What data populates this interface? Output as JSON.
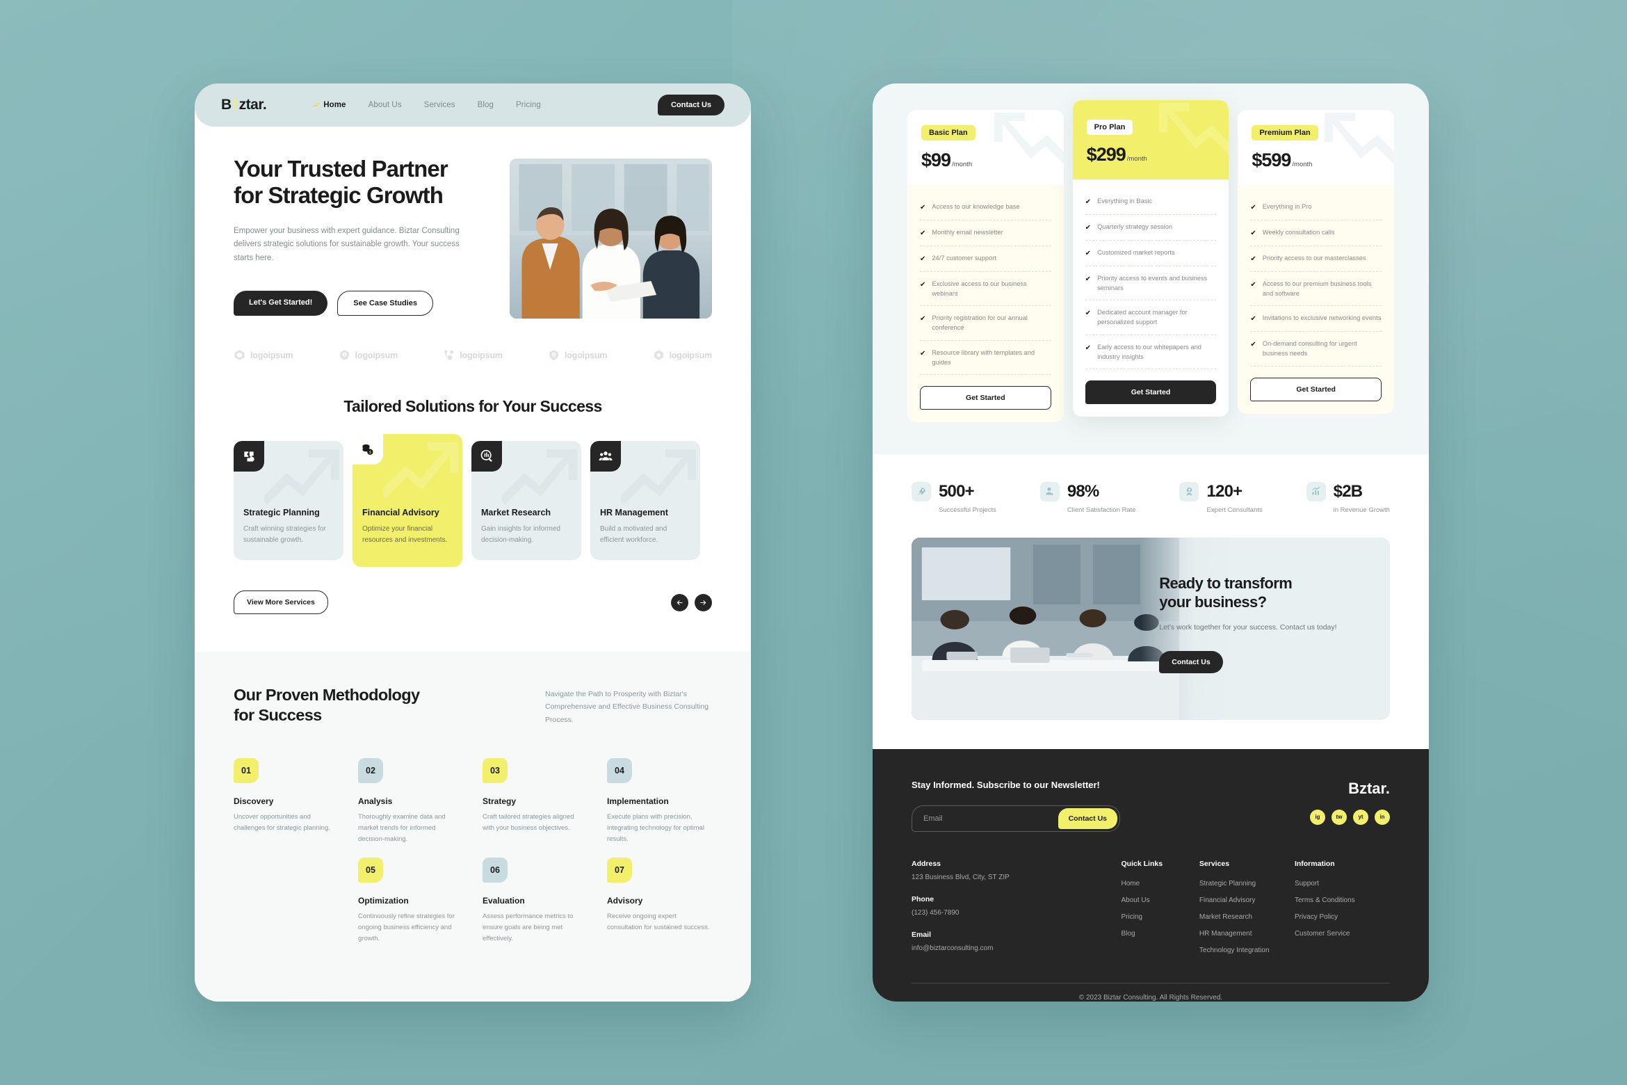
{
  "brand": {
    "name_pre": "B",
    "name_post": "ztar.",
    "logo_icon": "arrow-up-icon"
  },
  "nav": {
    "items": [
      {
        "label": "Home",
        "active": true
      },
      {
        "label": "About Us",
        "active": false
      },
      {
        "label": "Services",
        "active": false
      },
      {
        "label": "Blog",
        "active": false
      },
      {
        "label": "Pricing",
        "active": false
      }
    ],
    "cta": "Contact Us"
  },
  "hero": {
    "title_line1": "Your Trusted Partner",
    "title_line2": "for Strategic Growth",
    "subtitle": "Empower your business with expert guidance. Biztar Consulting delivers strategic solutions for sustainable growth. Your success starts here.",
    "primary_btn": "Let's Get Started!",
    "secondary_btn": "See Case Studies"
  },
  "logos": [
    {
      "label": "logoipsum",
      "icon": "cube-icon"
    },
    {
      "label": "logoipsum",
      "icon": "shield-plus-icon"
    },
    {
      "label": "logoipsum",
      "icon": "molecule-icon"
    },
    {
      "label": "logoipsum",
      "icon": "shield-plus-icon"
    },
    {
      "label": "logoipsum",
      "icon": "hexagon-icon"
    }
  ],
  "services": {
    "title": "Tailored Solutions for Your Success",
    "cards": [
      {
        "title": "Strategic Planning",
        "desc": "Craft winning strategies for sustainable growth.",
        "icon": "puzzle-icon",
        "highlight": false
      },
      {
        "title": "Financial Advisory",
        "desc": "Optimize your financial resources and investments.",
        "icon": "coins-icon",
        "highlight": true
      },
      {
        "title": "Market Research",
        "desc": "Gain insights for informed decision-making.",
        "icon": "magnifier-chart-icon",
        "highlight": false
      },
      {
        "title": "HR Management",
        "desc": "Build a motivated and efficient workforce.",
        "icon": "people-icon",
        "highlight": false
      }
    ],
    "view_more": "View More Services",
    "prev_icon": "arrow-left-icon",
    "next_icon": "arrow-right-icon"
  },
  "methodology": {
    "title_line1": "Our Proven Methodology",
    "title_line2": "for Success",
    "description": "Navigate the Path to Prosperity with Biztar's Comprehensive and Effective Business Consulting Process.",
    "steps": [
      {
        "num": "01",
        "color": "y",
        "title": "Discovery",
        "desc": "Uncover opportunities and challenges for strategic planning."
      },
      {
        "num": "02",
        "color": "b",
        "title": "Analysis",
        "desc": "Thoroughly examine data and market trends for informed decision-making."
      },
      {
        "num": "03",
        "color": "y",
        "title": "Strategy",
        "desc": "Craft tailored strategies aligned with your business objectives."
      },
      {
        "num": "04",
        "color": "b",
        "title": "Implementation",
        "desc": "Execute plans with precision, integrating technology for optimal results."
      },
      {
        "num": "05",
        "color": "y",
        "title": "Optimization",
        "desc": "Continuously refine strategies for ongoing business efficiency and growth."
      },
      {
        "num": "06",
        "color": "b",
        "title": "Evaluation",
        "desc": "Assess performance metrics to ensure goals are being met effectively."
      },
      {
        "num": "07",
        "color": "y",
        "title": "Advisory",
        "desc": "Receive ongoing expert consultation for sustained success."
      }
    ]
  },
  "pricing": {
    "plans": [
      {
        "badge": "Basic Plan",
        "price": "$99",
        "period": "/month",
        "featured": false,
        "cta": "Get Started",
        "features": [
          "Access to our knowledge base",
          "Monthly email newsletter",
          "24/7 customer support",
          "Exclusive access to our business webinars",
          "Priority registration for our annual conference",
          "Resource library with templates and guides"
        ]
      },
      {
        "badge": "Pro Plan",
        "price": "$299",
        "period": "/month",
        "featured": true,
        "cta": "Get Started",
        "features": [
          "Everything in Basic",
          "Quarterly strategy session",
          "Customized market reports",
          "Priority access to events and business seminars",
          "Dedicated account manager for personalized support",
          "Early access to our whitepapers and industry insights"
        ]
      },
      {
        "badge": "Premium Plan",
        "price": "$599",
        "period": "/month",
        "featured": false,
        "cta": "Get Started",
        "features": [
          "Everything in Pro",
          "Weekly consultation calls",
          "Priority access to our masterclasses",
          "Access to our premium business tools and software",
          "Invitations to exclusive networking events",
          "On-demand consulting for urgent business needs"
        ]
      }
    ]
  },
  "stats": [
    {
      "value": "500+",
      "label": "Successful Projects",
      "icon": "rocket-icon"
    },
    {
      "value": "98%",
      "label": "Client Satisfaction Rate",
      "icon": "user-star-icon"
    },
    {
      "value": "120+",
      "label": "Expert Consultants",
      "icon": "badge-person-icon"
    },
    {
      "value": "$2B",
      "label": "in Revenue Growth",
      "icon": "bar-chart-icon"
    }
  ],
  "cta_band": {
    "heading_line1": "Ready to transform",
    "heading_line2": "your business?",
    "sub": "Let's work together for your success. Contact us today!",
    "button": "Contact Us"
  },
  "footer": {
    "newsletter_title": "Stay Informed. Subscribe to our Newsletter!",
    "email_placeholder": "Email",
    "email_value": "",
    "subscribe_btn": "Contact Us",
    "social": [
      {
        "label": "ig",
        "name": "instagram-icon"
      },
      {
        "label": "tw",
        "name": "twitter-icon"
      },
      {
        "label": "yt",
        "name": "youtube-icon"
      },
      {
        "label": "in",
        "name": "linkedin-icon"
      }
    ],
    "address_label": "Address",
    "address_value": "123 Business Blvd, City, ST ZIP",
    "phone_label": "Phone",
    "phone_value": "(123) 456-7890",
    "email_label": "Email",
    "email_addr": "info@biztarconsulting.com",
    "columns": [
      {
        "title": "Quick Links",
        "links": [
          "Home",
          "About Us",
          "Pricing",
          "Blog"
        ]
      },
      {
        "title": "Services",
        "links": [
          "Strategic Planning",
          "Financial Advisory",
          "Market Research",
          "HR Management",
          "Technology Integration"
        ]
      },
      {
        "title": "Information",
        "links": [
          "Support",
          "Terms & Conditions",
          "Privacy Policy",
          "Customer Service"
        ]
      }
    ],
    "copyright": "© 2023 Biztar Consulting. All Rights Reserved."
  },
  "colors": {
    "accent": "#F2F06A",
    "dark": "#262626",
    "page_bg": "#7FB3B5",
    "tint": "#D6E4E5"
  }
}
